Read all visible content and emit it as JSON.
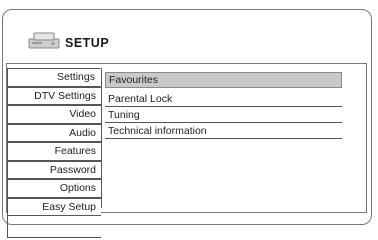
{
  "header": {
    "title": "SETUP",
    "icon": "dvd-player-icon"
  },
  "sidebar": {
    "items": [
      {
        "label": "Settings"
      },
      {
        "label": "DTV Settings"
      },
      {
        "label": "Video"
      },
      {
        "label": "Audio"
      },
      {
        "label": "Features"
      },
      {
        "label": "Password"
      },
      {
        "label": "Options"
      },
      {
        "label": "Easy Setup"
      }
    ]
  },
  "menu": {
    "items": [
      {
        "label": "Favourites"
      },
      {
        "label": "Parental Lock"
      },
      {
        "label": "Tuning"
      },
      {
        "label": "Technical information"
      }
    ]
  }
}
